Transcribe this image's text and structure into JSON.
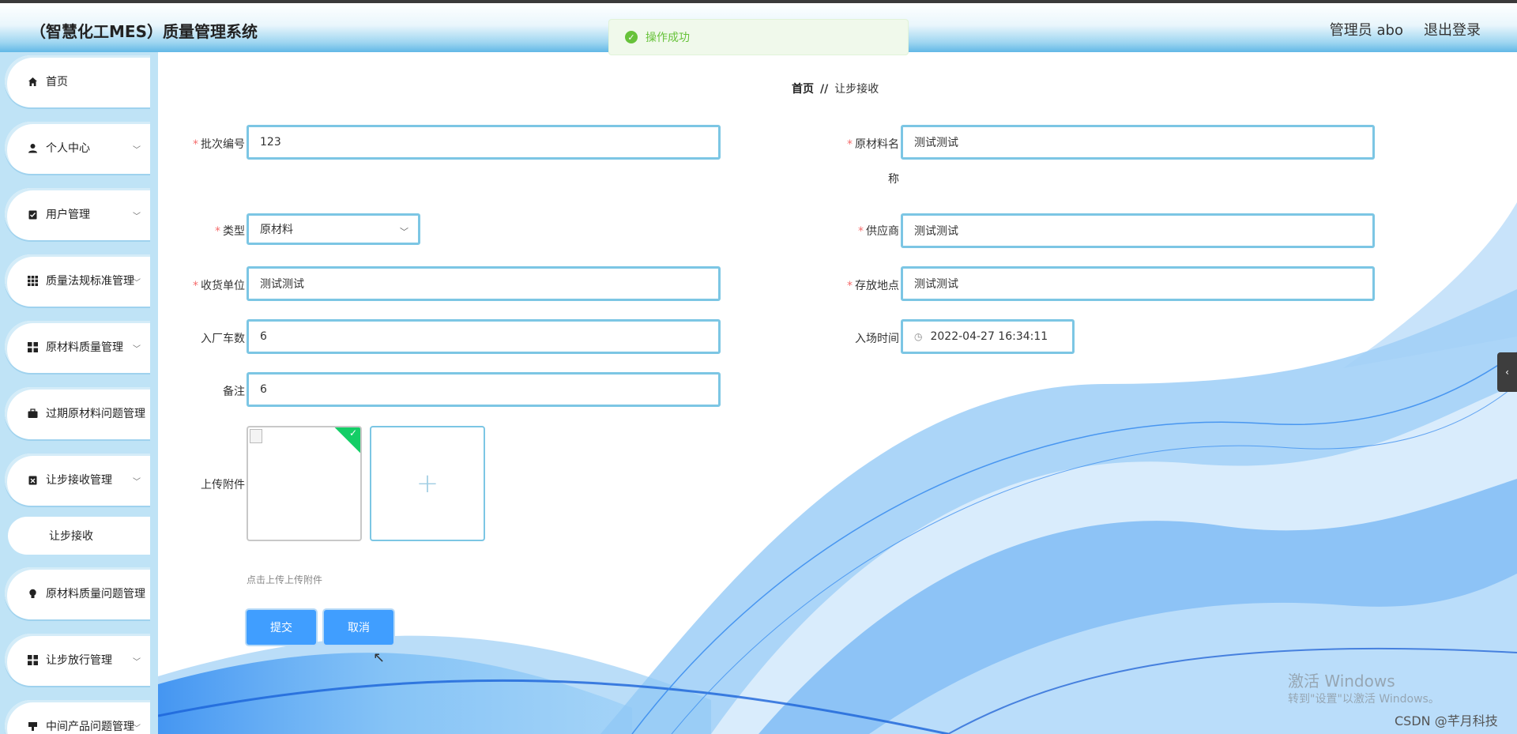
{
  "header": {
    "title": "（智慧化工MES）质量管理系统",
    "user": "管理员 abo",
    "logout": "退出登录"
  },
  "toast": {
    "message": "操作成功"
  },
  "sidebar": {
    "items": [
      {
        "label": "首页",
        "icon": "home-icon"
      },
      {
        "label": "个人中心",
        "icon": "user-icon"
      },
      {
        "label": "用户管理",
        "icon": "clipboard-icon"
      },
      {
        "label": "质量法规标准管理",
        "icon": "grid-icon"
      },
      {
        "label": "原材料质量管理",
        "icon": "apps-icon"
      },
      {
        "label": "过期原材料问题管理",
        "icon": "briefcase-icon"
      },
      {
        "label": "让步接收管理",
        "icon": "clipboard-x-icon"
      },
      {
        "label": "原材料质量问题管理",
        "icon": "bulb-icon"
      },
      {
        "label": "让步放行管理",
        "icon": "apps-icon"
      },
      {
        "label": "中间产品问题管理",
        "icon": "stamp-icon"
      }
    ],
    "sub_item": "让步接收"
  },
  "breadcrumb": {
    "home": "首页",
    "separator": "//",
    "current": "让步接收"
  },
  "form": {
    "batch_no": {
      "label": "批次编号",
      "value": "123"
    },
    "material_name": {
      "label_line1": "原材料名",
      "label_line2": "称",
      "value": "测试测试"
    },
    "type": {
      "label": "类型",
      "value": "原材料"
    },
    "supplier": {
      "label": "供应商",
      "value": "测试测试"
    },
    "receiving_unit": {
      "label": "收货单位",
      "value": "测试测试"
    },
    "storage_location": {
      "label": "存放地点",
      "value": "测试测试"
    },
    "vehicles": {
      "label": "入厂车数",
      "value": "6"
    },
    "entry_time": {
      "label": "入场时间",
      "value": "2022-04-27 16:34:11"
    },
    "remark": {
      "label": "备注",
      "value": "6"
    },
    "attachment": {
      "label": "上传附件",
      "tip": "点击上传上传附件"
    }
  },
  "buttons": {
    "submit": "提交",
    "cancel": "取消"
  },
  "watermarks": {
    "win_line1": "激活 Windows",
    "win_line2": "转到\"设置\"以激活 Windows。",
    "csdn": "CSDN @芊月科技"
  }
}
